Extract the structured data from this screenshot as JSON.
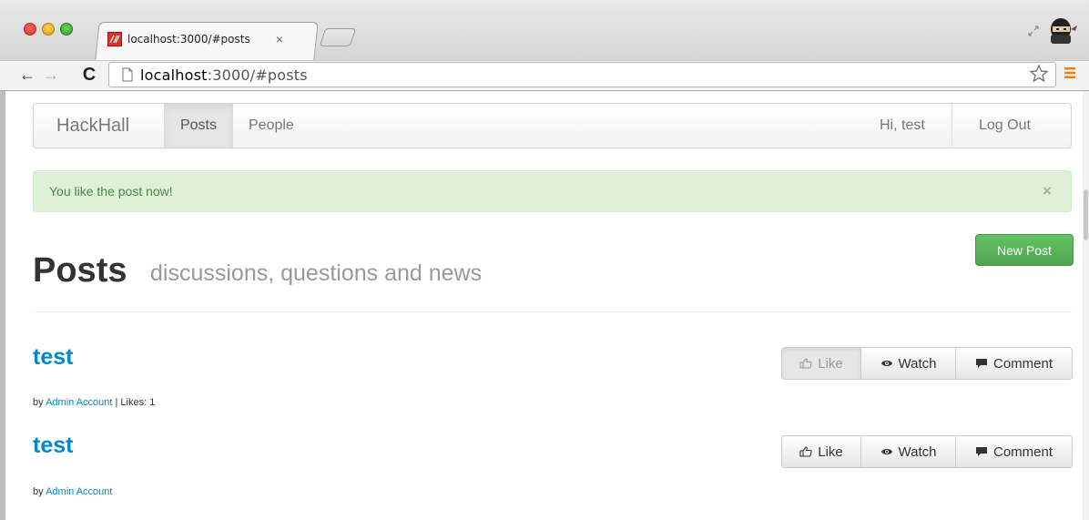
{
  "browser": {
    "tab_title": "localhost:3000/#posts",
    "tab_close": "×",
    "url_host": "localhost",
    "url_rest": ":3000/#posts"
  },
  "nav": {
    "brand": "HackHall",
    "items": [
      {
        "label": "Posts"
      },
      {
        "label": "People"
      }
    ],
    "greeting": "Hi, test",
    "logout": "Log Out"
  },
  "alert": {
    "message": "You like the post now!",
    "close": "×"
  },
  "header": {
    "title": "Posts",
    "subtitle": "discussions, questions and news",
    "new_post": "New Post"
  },
  "posts": [
    {
      "title": "test",
      "by_prefix": "by ",
      "author": "Admin Account",
      "likes_text": " | Likes: 1",
      "like_label": "Like",
      "watch_label": "Watch",
      "comment_label": "Comment"
    },
    {
      "title": "test",
      "by_prefix": "by ",
      "author": "Admin Account",
      "likes_text": "",
      "like_label": "Like",
      "watch_label": "Watch",
      "comment_label": "Comment"
    }
  ],
  "colors": {
    "link": "#0088cc",
    "success": "#51a351",
    "alert_bg": "#dff0d8",
    "alert_text": "#468847"
  }
}
